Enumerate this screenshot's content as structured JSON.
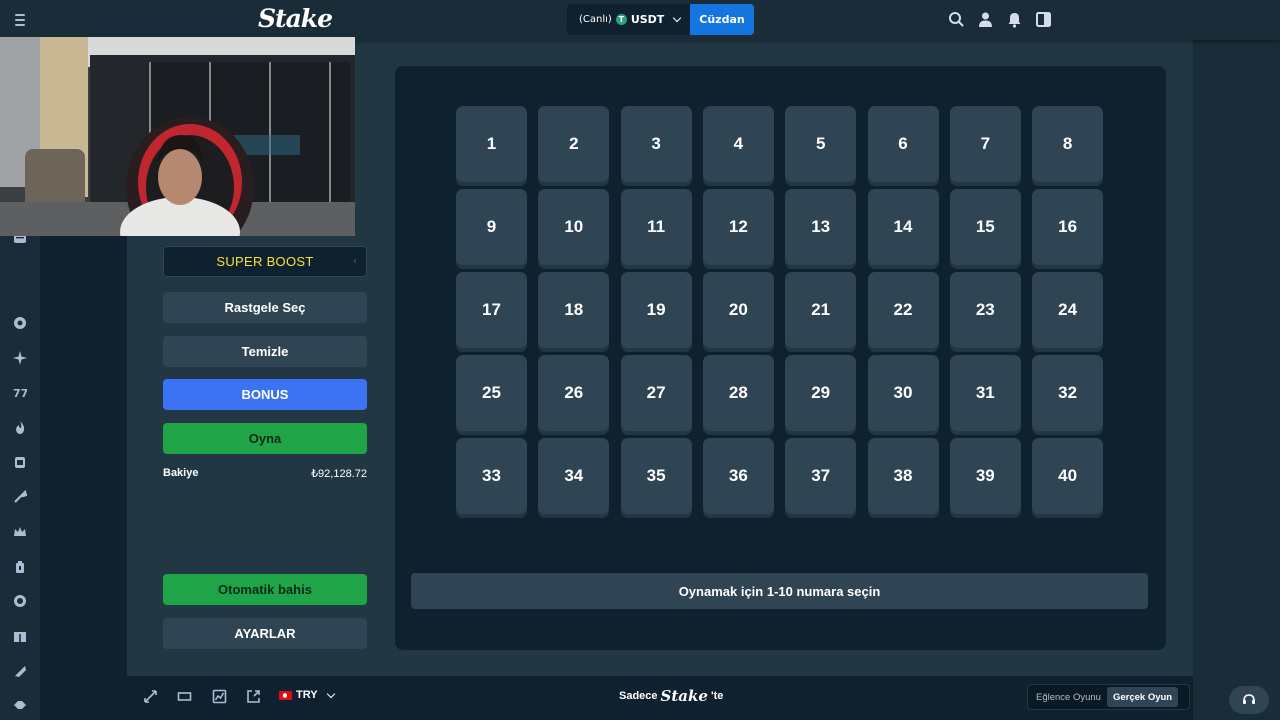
{
  "header": {
    "logo": "Stake",
    "wallet_prefix": "(Canlı)",
    "currency": "USDT",
    "currency_icon": "T",
    "wallet_button": "Cüzdan"
  },
  "controls": {
    "super_boost": "SUPER BOOST",
    "random_pick": "Rastgele Seç",
    "clear": "Temizle",
    "bonus": "BONUS",
    "play": "Oyna",
    "balance_label": "Bakiye",
    "balance_value": "₺92,128.72",
    "auto_bet": "Otomatik bahis",
    "settings": "AYARLAR"
  },
  "board": {
    "numbers": [
      "1",
      "2",
      "3",
      "4",
      "5",
      "6",
      "7",
      "8",
      "9",
      "10",
      "11",
      "12",
      "13",
      "14",
      "15",
      "16",
      "17",
      "18",
      "19",
      "20",
      "21",
      "22",
      "23",
      "24",
      "25",
      "26",
      "27",
      "28",
      "29",
      "30",
      "31",
      "32",
      "33",
      "34",
      "35",
      "36",
      "37",
      "38",
      "39",
      "40"
    ],
    "instruction": "Oynamak için 1-10 numara seçin"
  },
  "footer": {
    "currency": "TRY",
    "brand_prefix": "Sadece",
    "brand_logo": "Stake",
    "brand_suffix": "'te",
    "fun_mode": "Eğlence Oyunu",
    "real_mode": "Gerçek Oyun"
  },
  "colors": {
    "bg": "#0f212e",
    "panel": "#1a2c38",
    "tile": "#2f4553",
    "blue": "#1475e1",
    "bonus_blue": "#3b73f2",
    "green": "#1fa547",
    "boost_yellow": "#f5e33b"
  },
  "icons": [
    "menu-icon",
    "search-icon",
    "user-icon",
    "bell-icon",
    "sidebar-toggle-icon",
    "fullscreen-icon",
    "theatre-icon",
    "stats-icon",
    "popout-icon",
    "chevron-down-icon",
    "headset-icon"
  ]
}
